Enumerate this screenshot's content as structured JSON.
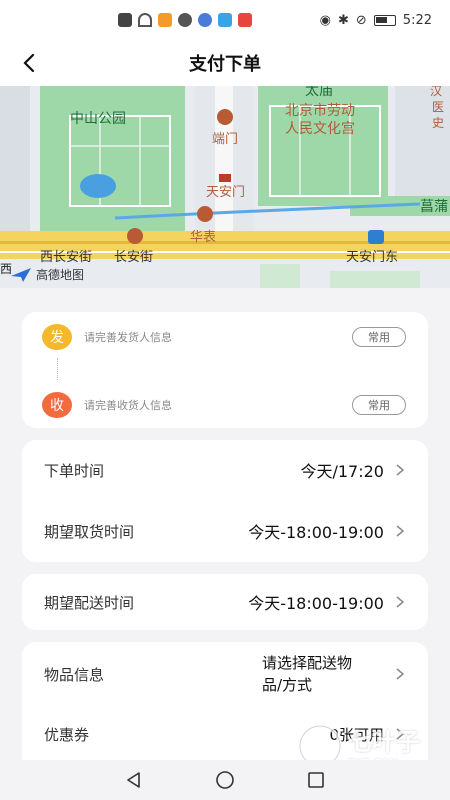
{
  "status": {
    "time": "5:22"
  },
  "header": {
    "title": "支付下单"
  },
  "map": {
    "labels": {
      "zhongshan_park": "中山公园",
      "taimiao": "太庙",
      "labor_palace_1": "北京市劳动",
      "labor_palace_2": "人民文化宫",
      "duanmen": "端门",
      "tiananmen": "天安门",
      "huabiao": "华表",
      "west_changan": "西长安街",
      "changan": "长安街",
      "tiananmen_east": "天安门东",
      "gaode": "高德地图",
      "xi": "西",
      "changpu": "菖蒲",
      "right_1": "汉",
      "right_2": "医",
      "right_3": "史"
    }
  },
  "address": {
    "sender_badge": "发",
    "sender_hint": "请完善发货人信息",
    "sender_chip": "常用",
    "receiver_badge": "收",
    "receiver_hint": "请完善收货人信息",
    "receiver_chip": "常用"
  },
  "order_time": {
    "label": "下单时间",
    "value": "今天/17:20"
  },
  "pickup_time": {
    "label": "期望取货时间",
    "value": "今天-18:00-19:00"
  },
  "delivery_time": {
    "label": "期望配送时间",
    "value": "今天-18:00-19:00"
  },
  "goods": {
    "label": "物品信息",
    "value_line1": "请选择配送物",
    "value_line2": "品/方式"
  },
  "coupon": {
    "label": "优惠券",
    "value": "0张可用"
  },
  "watermark": {
    "text": "七叶子",
    "sub": "7YZ.COM"
  },
  "colors": {
    "sender": "#f5b82a",
    "receiver": "#f26a3d",
    "map_green": "#9fd8a8",
    "road_yellow": "#f4d35e"
  }
}
